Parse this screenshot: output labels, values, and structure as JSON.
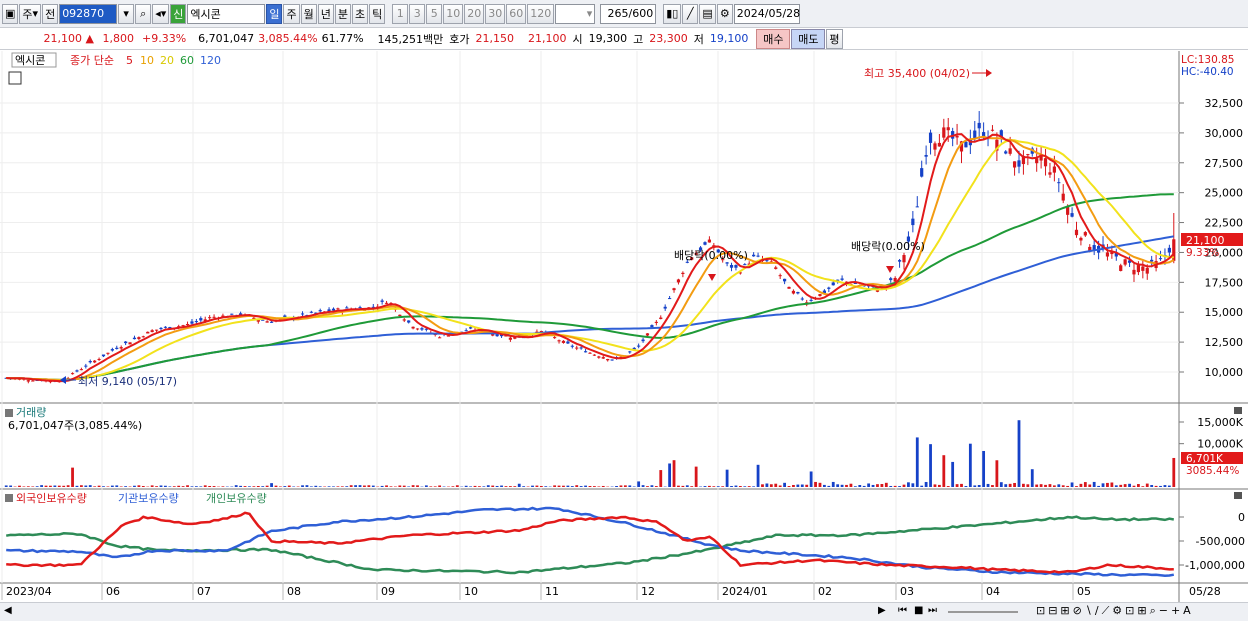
{
  "toolbar": {
    "market": "주",
    "prev": "전",
    "code": "092870",
    "badge": "신",
    "name": "엑시콘",
    "periods": [
      "일",
      "주",
      "월",
      "년",
      "분",
      "초",
      "틱"
    ],
    "period_selected": "일",
    "minutes": [
      "1",
      "3",
      "5",
      "10",
      "20",
      "30",
      "60",
      "120"
    ],
    "count": "265",
    "total": "/600",
    "date": "2024/05/28"
  },
  "quote": {
    "price": "21,100",
    "arrow": "▲",
    "change": "1,800",
    "pct": "+9.33%",
    "volume": "6,701,047",
    "vol_ratio": "3,085.44%",
    "turnover": "61.77%",
    "amount": "145,251백만",
    "ask_label": "호가",
    "ask": "21,150",
    "bid": "21,100",
    "open_label": "시",
    "open": "19,300",
    "high_label": "고",
    "high": "23,300",
    "low_label": "저",
    "low": "19,100",
    "buy": "매수",
    "sell": "매도",
    "eval": "평"
  },
  "price_legend": {
    "name": "엑시콘",
    "ma_label": "종가 단순",
    "ma5": "5",
    "ma10": "10",
    "ma20": "20",
    "ma60": "60",
    "ma120": "120"
  },
  "price_panel": {
    "lc": "LC:130.85",
    "hc": "HC:-40.40",
    "high_note": "최고 35,400 (04/02)",
    "low_note": "최저 9,140 (05/17)",
    "div1": "배당락(0.00%)",
    "div2": "배당락(0.00%)",
    "cur_price": "21,100",
    "cur_pct": "9.33%",
    "y_labels": [
      "32,500",
      "30,000",
      "27,500",
      "25,000",
      "22,500",
      "20,000",
      "17,500",
      "15,000",
      "12,500",
      "10,000"
    ]
  },
  "volume_panel": {
    "title": "거래량",
    "value": "6,701,047주(3,085.44%)",
    "y_labels": [
      "15,000K",
      "10,000K"
    ],
    "cur_vol": "6,701K",
    "cur_pct": "3085.44%"
  },
  "holdings_panel": {
    "s1": "외국인보유수량",
    "s2": "기관보유수량",
    "s3": "개인보유수량",
    "y_labels": [
      "0",
      "-500,000",
      "-1,000,000"
    ]
  },
  "x_labels": [
    "2023/04",
    "06",
    "07",
    "08",
    "09",
    "10",
    "11",
    "12",
    "2024/01",
    "02",
    "03",
    "04",
    "05",
    "05/28"
  ],
  "colors": {
    "up": "#d8161b",
    "down": "#1541c8",
    "ma5": "#e21a1a",
    "ma10": "#f39c12",
    "ma20": "#f2e21c",
    "ma60": "#1f9a38",
    "ma120": "#2f5fd6",
    "foreign": "#e21a1a",
    "inst": "#2f5fd6",
    "indiv": "#2e8b57"
  }
}
